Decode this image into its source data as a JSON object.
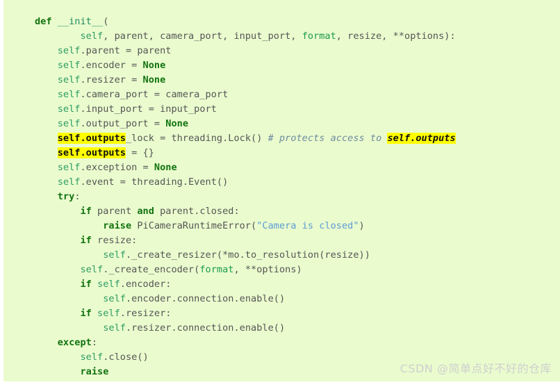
{
  "theme": {
    "background": "#eafcce",
    "page_background": "#ffffff",
    "highlight_background": "#ffff00",
    "highlight_text": "#111111",
    "keyword_color": "#137310",
    "self_color": "#2e9c63",
    "function_name_color": "#1f8a63",
    "builtin_color": "#1a9a4e",
    "plain_color": "#555555",
    "string_color": "#5b9bd5",
    "comment_color": "#6e8ba0",
    "watermark_color": "#cfcfcf"
  },
  "watermark": {
    "text": "CSDN @简单点好不好的仓库"
  },
  "code": {
    "language": "python",
    "plain_text": "    def __init__(\n            self, parent, camera_port, input_port, format, resize, **options):\n        self.parent = parent\n        self.encoder = None\n        self.resizer = None\n        self.camera_port = camera_port\n        self.input_port = input_port\n        self.output_port = None\n        self.outputs_lock = threading.Lock() # protects access to self.outputs\n        self.outputs = {}\n        self.exception = None\n        self.event = threading.Event()\n        try:\n            if parent and parent.closed:\n                raise PiCameraRuntimeError(\"Camera is closed\")\n            if resize:\n                self._create_resizer(*mo.to_resolution(resize))\n            self._create_encoder(format, **options)\n            if self.encoder:\n                self.encoder.connection.enable()\n            if self.resizer:\n                self.resizer.connection.enable()\n        except:\n            self.close()\n            raise",
    "lines": [
      {
        "id": "line-1",
        "tokens": [
          {
            "t": "def",
            "c": "kw"
          },
          {
            "t": " ",
            "c": "plain"
          },
          {
            "t": "__init__",
            "c": "fname"
          },
          {
            "t": "(",
            "c": "plain"
          }
        ]
      },
      {
        "id": "line-2",
        "tokens": [
          {
            "t": "        ",
            "c": "plain"
          },
          {
            "t": "self",
            "c": "self"
          },
          {
            "t": ", parent, camera_port, input_port, ",
            "c": "plain"
          },
          {
            "t": "format",
            "c": "builtin"
          },
          {
            "t": ", resize, **options):",
            "c": "plain"
          }
        ]
      },
      {
        "id": "line-3",
        "tokens": [
          {
            "t": "    ",
            "c": "plain"
          },
          {
            "t": "self",
            "c": "self"
          },
          {
            "t": ".parent = parent",
            "c": "plain"
          }
        ]
      },
      {
        "id": "line-4",
        "tokens": [
          {
            "t": "    ",
            "c": "plain"
          },
          {
            "t": "self",
            "c": "self"
          },
          {
            "t": ".encoder = ",
            "c": "plain"
          },
          {
            "t": "None",
            "c": "kw"
          }
        ]
      },
      {
        "id": "line-5",
        "tokens": [
          {
            "t": "    ",
            "c": "plain"
          },
          {
            "t": "self",
            "c": "self"
          },
          {
            "t": ".resizer = ",
            "c": "plain"
          },
          {
            "t": "None",
            "c": "kw"
          }
        ]
      },
      {
        "id": "line-6",
        "tokens": [
          {
            "t": "    ",
            "c": "plain"
          },
          {
            "t": "self",
            "c": "self"
          },
          {
            "t": ".camera_port = camera_port",
            "c": "plain"
          }
        ]
      },
      {
        "id": "line-7",
        "tokens": [
          {
            "t": "    ",
            "c": "plain"
          },
          {
            "t": "self",
            "c": "self"
          },
          {
            "t": ".input_port = input_port",
            "c": "plain"
          }
        ]
      },
      {
        "id": "line-8",
        "tokens": [
          {
            "t": "    ",
            "c": "plain"
          },
          {
            "t": "self",
            "c": "self"
          },
          {
            "t": ".output_port = ",
            "c": "plain"
          },
          {
            "t": "None",
            "c": "kw"
          }
        ]
      },
      {
        "id": "line-9",
        "tokens": [
          {
            "t": "    ",
            "c": "plain"
          },
          {
            "t": "self.outputs",
            "c": "hl"
          },
          {
            "t": "_lock = threading.Lock() ",
            "c": "plain"
          },
          {
            "t": "# protects access to ",
            "c": "comment"
          },
          {
            "t": "self.outputs",
            "c": "hl-c"
          }
        ]
      },
      {
        "id": "line-10",
        "tokens": [
          {
            "t": "    ",
            "c": "plain"
          },
          {
            "t": "self.outputs",
            "c": "hl"
          },
          {
            "t": " = {}",
            "c": "plain"
          }
        ]
      },
      {
        "id": "line-11",
        "tokens": [
          {
            "t": "    ",
            "c": "plain"
          },
          {
            "t": "self",
            "c": "self"
          },
          {
            "t": ".exception = ",
            "c": "plain"
          },
          {
            "t": "None",
            "c": "kw"
          }
        ]
      },
      {
        "id": "line-12",
        "tokens": [
          {
            "t": "    ",
            "c": "plain"
          },
          {
            "t": "self",
            "c": "self"
          },
          {
            "t": ".event = threading.Event()",
            "c": "plain"
          }
        ]
      },
      {
        "id": "line-13",
        "tokens": [
          {
            "t": "    ",
            "c": "plain"
          },
          {
            "t": "try",
            "c": "kw"
          },
          {
            "t": ":",
            "c": "plain"
          }
        ]
      },
      {
        "id": "line-14",
        "tokens": [
          {
            "t": "        ",
            "c": "plain"
          },
          {
            "t": "if",
            "c": "kw"
          },
          {
            "t": " parent ",
            "c": "plain"
          },
          {
            "t": "and",
            "c": "kw"
          },
          {
            "t": " parent.closed:",
            "c": "plain"
          }
        ]
      },
      {
        "id": "line-15",
        "tokens": [
          {
            "t": "            ",
            "c": "plain"
          },
          {
            "t": "raise",
            "c": "kw"
          },
          {
            "t": " PiCameraRuntimeError(",
            "c": "plain"
          },
          {
            "t": "\"Camera is closed\"",
            "c": "str"
          },
          {
            "t": ")",
            "c": "plain"
          }
        ]
      },
      {
        "id": "line-16",
        "tokens": [
          {
            "t": "        ",
            "c": "plain"
          },
          {
            "t": "if",
            "c": "kw"
          },
          {
            "t": " resize:",
            "c": "plain"
          }
        ]
      },
      {
        "id": "line-17",
        "tokens": [
          {
            "t": "            ",
            "c": "plain"
          },
          {
            "t": "self",
            "c": "self"
          },
          {
            "t": "._create_resizer(*mo.to_resolution(resize))",
            "c": "plain"
          }
        ]
      },
      {
        "id": "line-18",
        "tokens": [
          {
            "t": "        ",
            "c": "plain"
          },
          {
            "t": "self",
            "c": "self"
          },
          {
            "t": "._create_encoder(",
            "c": "plain"
          },
          {
            "t": "format",
            "c": "builtin"
          },
          {
            "t": ", **options)",
            "c": "plain"
          }
        ]
      },
      {
        "id": "line-19",
        "tokens": [
          {
            "t": "        ",
            "c": "plain"
          },
          {
            "t": "if",
            "c": "kw"
          },
          {
            "t": " ",
            "c": "plain"
          },
          {
            "t": "self",
            "c": "self"
          },
          {
            "t": ".encoder:",
            "c": "plain"
          }
        ]
      },
      {
        "id": "line-20",
        "tokens": [
          {
            "t": "            ",
            "c": "plain"
          },
          {
            "t": "self",
            "c": "self"
          },
          {
            "t": ".encoder.connection.enable()",
            "c": "plain"
          }
        ]
      },
      {
        "id": "line-21",
        "tokens": [
          {
            "t": "        ",
            "c": "plain"
          },
          {
            "t": "if",
            "c": "kw"
          },
          {
            "t": " ",
            "c": "plain"
          },
          {
            "t": "self",
            "c": "self"
          },
          {
            "t": ".resizer:",
            "c": "plain"
          }
        ]
      },
      {
        "id": "line-22",
        "tokens": [
          {
            "t": "            ",
            "c": "plain"
          },
          {
            "t": "self",
            "c": "self"
          },
          {
            "t": ".resizer.connection.enable()",
            "c": "plain"
          }
        ]
      },
      {
        "id": "line-23",
        "tokens": [
          {
            "t": "    ",
            "c": "plain"
          },
          {
            "t": "except",
            "c": "kw"
          },
          {
            "t": ":",
            "c": "plain"
          }
        ]
      },
      {
        "id": "line-24",
        "tokens": [
          {
            "t": "        ",
            "c": "plain"
          },
          {
            "t": "self",
            "c": "self"
          },
          {
            "t": ".close()",
            "c": "plain"
          }
        ]
      },
      {
        "id": "line-25",
        "tokens": [
          {
            "t": "        ",
            "c": "plain"
          },
          {
            "t": "raise",
            "c": "kw"
          }
        ]
      }
    ]
  }
}
